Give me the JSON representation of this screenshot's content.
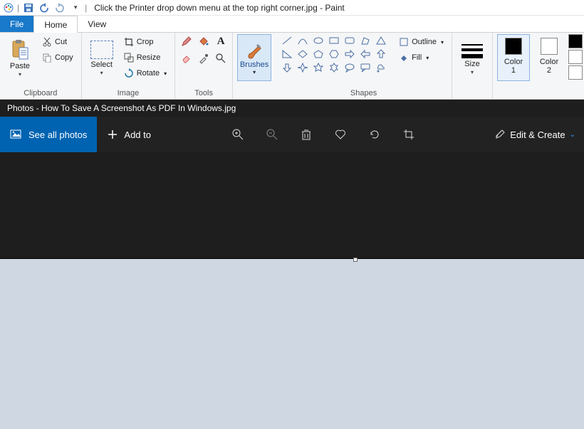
{
  "title": "Click the Printer drop down menu at the top right corner.jpg - Paint",
  "tabs": {
    "file": "File",
    "home": "Home",
    "view": "View"
  },
  "clipboard": {
    "paste": "Paste",
    "cut": "Cut",
    "copy": "Copy",
    "label": "Clipboard"
  },
  "image": {
    "select": "Select",
    "crop": "Crop",
    "resize": "Resize",
    "rotate": "Rotate",
    "label": "Image"
  },
  "tools": {
    "label": "Tools"
  },
  "brushes": {
    "label": "Brushes"
  },
  "shapes": {
    "outline": "Outline",
    "fill": "Fill",
    "label": "Shapes"
  },
  "size": {
    "label": "Size"
  },
  "colors": {
    "c1": "Color\n1",
    "c2": "Color\n2",
    "c1_hex": "#000000",
    "c2_hex": "#ffffff"
  },
  "palette": [
    "#000000",
    "#7f7f7f",
    "#a0231b",
    "#ffffff",
    "#c3c3c3",
    "#d87b3d",
    "#ffffff",
    "#ffffff",
    "#ffffff"
  ],
  "photos": {
    "title": "Photos - How To Save A Screenshot As PDF In Windows.jpg",
    "see_all": "See all photos",
    "add_to": "Add to",
    "edit_create": "Edit & Create"
  }
}
